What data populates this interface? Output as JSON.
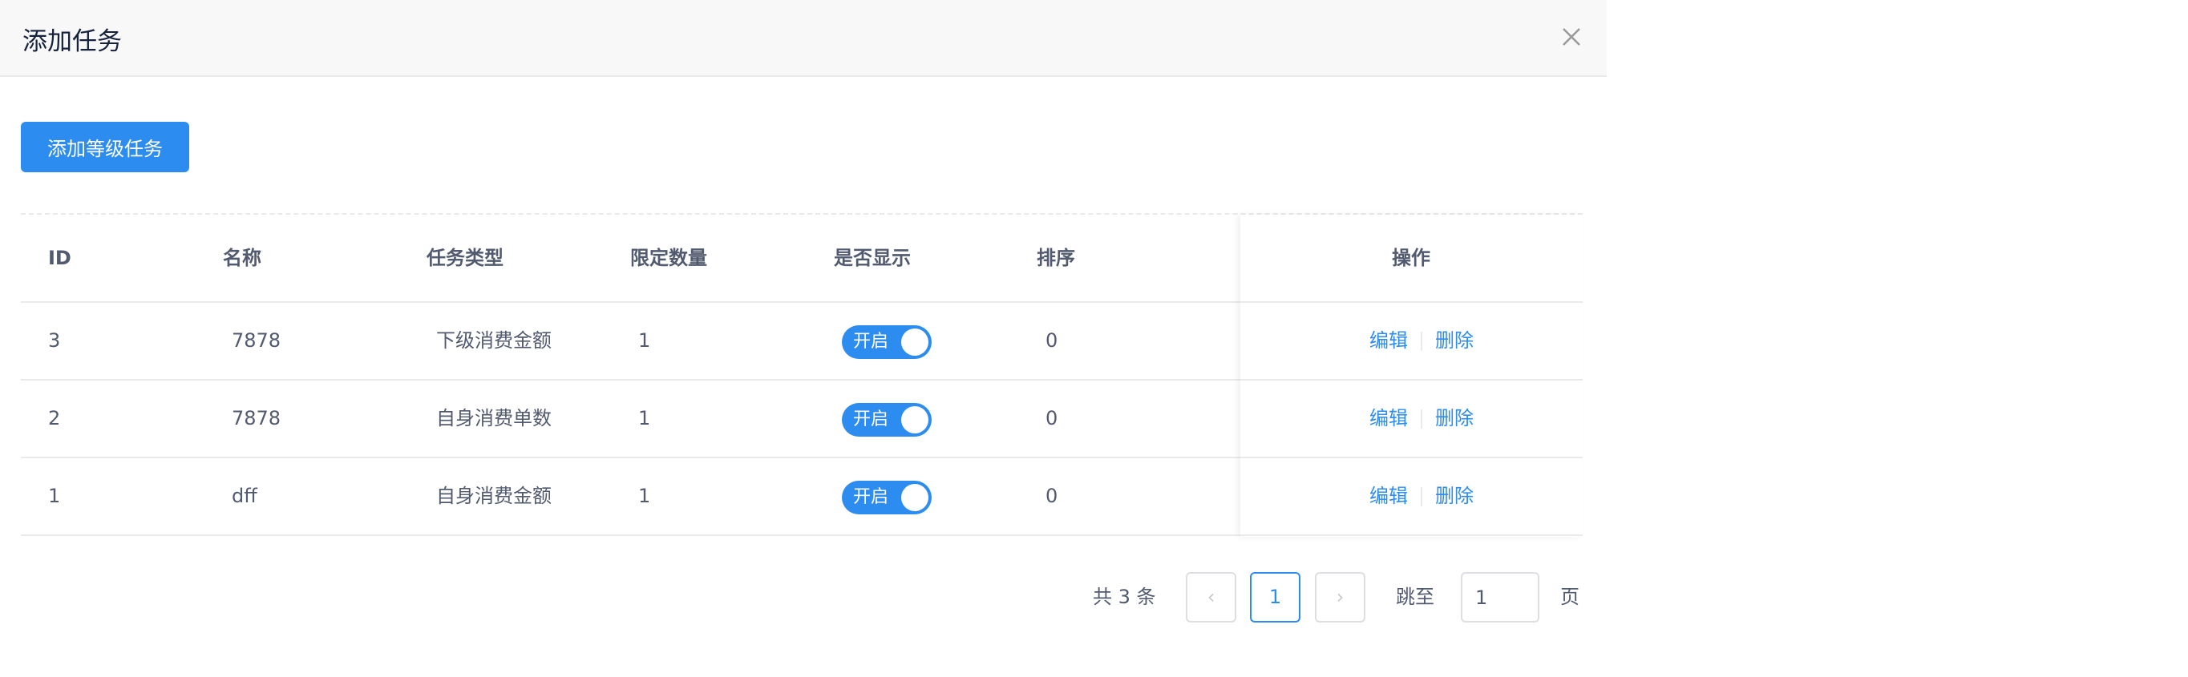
{
  "dialog": {
    "title": "添加任务",
    "close_icon": "close-icon"
  },
  "toolbar": {
    "add_label": "添加等级任务"
  },
  "table": {
    "columns": [
      "ID",
      "名称",
      "任务类型",
      "限定数量",
      "是否显示",
      "排序",
      "操作"
    ],
    "rows": [
      {
        "id": "3",
        "name": "7878",
        "type": "下级消费金额",
        "limit": "1",
        "show": "开启",
        "sort": "0",
        "edit": "编辑",
        "delete": "删除"
      },
      {
        "id": "2",
        "name": "7878",
        "type": "自身消费单数",
        "limit": "1",
        "show": "开启",
        "sort": "0",
        "edit": "编辑",
        "delete": "删除"
      },
      {
        "id": "1",
        "name": "dff",
        "type": "自身消费金额",
        "limit": "1",
        "show": "开启",
        "sort": "0",
        "edit": "编辑",
        "delete": "删除"
      }
    ]
  },
  "pagination": {
    "total_text": "共 3 条",
    "prev": "‹",
    "current": "1",
    "next": "›",
    "jump_label": "跳至",
    "jump_value": "1",
    "page_suffix": "页"
  }
}
